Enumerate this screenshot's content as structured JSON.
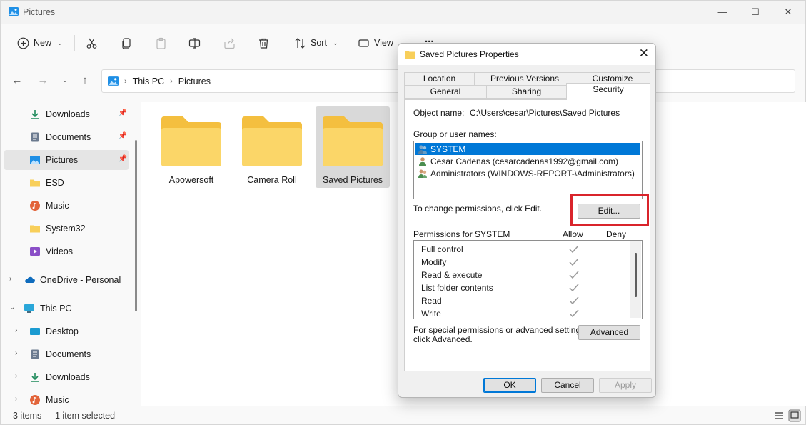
{
  "window": {
    "title": "Pictures",
    "minimize_glyph": "—",
    "maximize_glyph": "☐",
    "close_glyph": "✕"
  },
  "commandbar": {
    "new_label": "New",
    "sort_label": "Sort",
    "view_label": "View",
    "more_label": "..."
  },
  "address": {
    "crumbs": [
      "This PC",
      "Pictures"
    ]
  },
  "sidebar": {
    "quick_access": [
      {
        "label": "Downloads",
        "icon": "download-icon",
        "pinned": true
      },
      {
        "label": "Documents",
        "icon": "documents-icon",
        "pinned": true
      },
      {
        "label": "Pictures",
        "icon": "pictures-icon",
        "pinned": true,
        "selected": true
      },
      {
        "label": "ESD",
        "icon": "folder-icon",
        "pinned": false
      },
      {
        "label": "Music",
        "icon": "music-icon",
        "pinned": false
      },
      {
        "label": "System32",
        "icon": "folder-icon",
        "pinned": false
      },
      {
        "label": "Videos",
        "icon": "videos-icon",
        "pinned": false
      }
    ],
    "onedrive": "OneDrive - Personal",
    "thispc": "This PC",
    "thispc_children": [
      {
        "label": "Desktop",
        "icon": "desktop-icon"
      },
      {
        "label": "Documents",
        "icon": "documents-icon"
      },
      {
        "label": "Downloads",
        "icon": "download-icon"
      },
      {
        "label": "Music",
        "icon": "music-icon"
      }
    ]
  },
  "folders": [
    {
      "name": "Apowersoft",
      "selected": false
    },
    {
      "name": "Camera Roll",
      "selected": false
    },
    {
      "name": "Saved Pictures",
      "selected": true
    }
  ],
  "status": {
    "items": "3 items",
    "selected": "1 item selected"
  },
  "dialog": {
    "title": "Saved Pictures Properties",
    "tabs_row1": [
      "Location",
      "Previous Versions",
      "Customize"
    ],
    "tabs_row2": [
      "General",
      "Sharing",
      "Security"
    ],
    "active_tab": "Security",
    "object_name_label": "Object name:",
    "object_name_value": "C:\\Users\\cesar\\Pictures\\Saved Pictures",
    "group_label": "Group or user names:",
    "users": [
      {
        "name": "SYSTEM",
        "selected": true
      },
      {
        "name": "Cesar Cadenas (cesarcadenas1992@gmail.com)",
        "selected": false
      },
      {
        "name": "Administrators (WINDOWS-REPORT-\\Administrators)",
        "selected": false
      }
    ],
    "change_hint": "To change permissions, click Edit.",
    "edit_button": "Edit...",
    "permissions_label": "Permissions for SYSTEM",
    "allow_header": "Allow",
    "deny_header": "Deny",
    "permissions": [
      {
        "name": "Full control",
        "allow": true,
        "deny": false
      },
      {
        "name": "Modify",
        "allow": true,
        "deny": false
      },
      {
        "name": "Read & execute",
        "allow": true,
        "deny": false
      },
      {
        "name": "List folder contents",
        "allow": true,
        "deny": false
      },
      {
        "name": "Read",
        "allow": true,
        "deny": false
      },
      {
        "name": "Write",
        "allow": true,
        "deny": false
      }
    ],
    "advanced_hint_1": "For special permissions or advanced settings,",
    "advanced_hint_2": "click Advanced.",
    "advanced_button": "Advanced",
    "ok_button": "OK",
    "cancel_button": "Cancel",
    "apply_button": "Apply"
  },
  "colors": {
    "accent": "#0078d7",
    "highlight": "#d9242b",
    "folder": "#f8cf5a"
  }
}
